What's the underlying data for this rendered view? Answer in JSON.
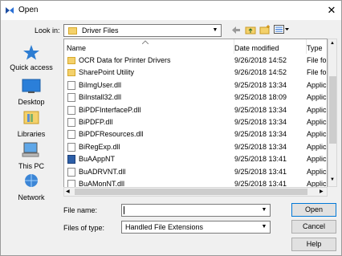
{
  "window": {
    "title": "Open",
    "close_glyph": "✕"
  },
  "toolbar": {
    "look_in_label": "Look in:",
    "look_in_value": "Driver Files"
  },
  "places": [
    {
      "label": "Quick access",
      "icon": "star-icon"
    },
    {
      "label": "Desktop",
      "icon": "desktop-icon"
    },
    {
      "label": "Libraries",
      "icon": "libraries-icon"
    },
    {
      "label": "This PC",
      "icon": "computer-icon"
    },
    {
      "label": "Network",
      "icon": "network-icon"
    }
  ],
  "columns": {
    "name": "Name",
    "date": "Date modified",
    "type": "Type"
  },
  "files": [
    {
      "name": "OCR Data for Printer Drivers",
      "date": "9/26/2018 14:52",
      "type": "File fol",
      "kind": "folder"
    },
    {
      "name": "SharePoint Utility",
      "date": "9/26/2018 14:52",
      "type": "File fol",
      "kind": "folder"
    },
    {
      "name": "BiImgUser.dll",
      "date": "9/25/2018 13:34",
      "type": "Applic",
      "kind": "file"
    },
    {
      "name": "BiInstall32.dll",
      "date": "9/25/2018 18:09",
      "type": "Applic",
      "kind": "file"
    },
    {
      "name": "BiPDFInterfaceP.dll",
      "date": "9/25/2018 13:34",
      "type": "Applic",
      "kind": "file"
    },
    {
      "name": "BiPDFP.dll",
      "date": "9/25/2018 13:34",
      "type": "Applic",
      "kind": "file"
    },
    {
      "name": "BiPDFResources.dll",
      "date": "9/25/2018 13:34",
      "type": "Applic",
      "kind": "file"
    },
    {
      "name": "BiRegExp.dll",
      "date": "9/25/2018 13:34",
      "type": "Applic",
      "kind": "file"
    },
    {
      "name": "BuAAppNT",
      "date": "9/25/2018 13:41",
      "type": "Applic",
      "kind": "app"
    },
    {
      "name": "BuADRVNT.dll",
      "date": "9/25/2018 13:41",
      "type": "Applic",
      "kind": "file"
    },
    {
      "name": "BuAMonNT.dll",
      "date": "9/25/2018 13:41",
      "type": "Applic",
      "kind": "file"
    }
  ],
  "form": {
    "filename_label": "File name:",
    "filename_value": "",
    "filetype_label": "Files of type:",
    "filetype_value": "Handled File Extensions"
  },
  "buttons": {
    "open": "Open",
    "cancel": "Cancel",
    "help": "Help"
  },
  "colors": {
    "accent": "#0078d7",
    "folder": "#f4d16b"
  }
}
